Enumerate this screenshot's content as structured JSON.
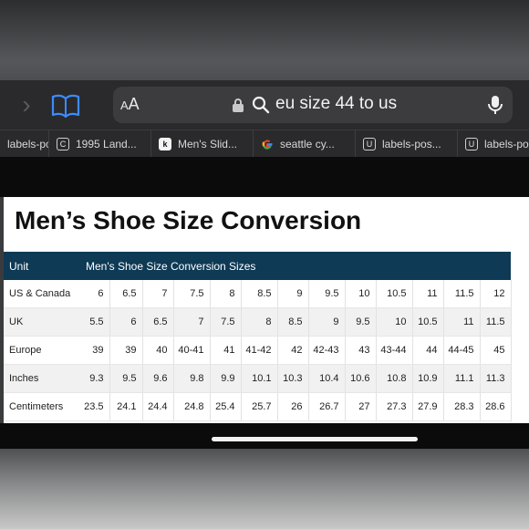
{
  "browser": {
    "text_size_label": "AA",
    "url": "eu size 44 to us",
    "tabs": [
      {
        "label": "labels-po",
        "icon": "U"
      },
      {
        "label": "1995 Land...",
        "icon": "C"
      },
      {
        "label": "Men's Slid...",
        "icon": "k"
      },
      {
        "label": "seattle cy...",
        "icon": "G"
      },
      {
        "label": "labels-pos...",
        "icon": "U"
      },
      {
        "label": "labels-po",
        "icon": "U"
      }
    ]
  },
  "page": {
    "title": "Men’s Shoe Size Conversion",
    "table": {
      "headers": [
        "Unit",
        "Men's Shoe Size Conversion Sizes"
      ],
      "rows": [
        {
          "label": "US & Canada",
          "values": [
            "6",
            "6.5",
            "7",
            "7.5",
            "8",
            "8.5",
            "9",
            "9.5",
            "10",
            "10.5",
            "11",
            "11.5",
            "12"
          ]
        },
        {
          "label": "UK",
          "values": [
            "5.5",
            "6",
            "6.5",
            "7",
            "7.5",
            "8",
            "8.5",
            "9",
            "9.5",
            "10",
            "10.5",
            "11",
            "11.5"
          ]
        },
        {
          "label": "Europe",
          "values": [
            "39",
            "39",
            "40",
            "40-41",
            "41",
            "41-42",
            "42",
            "42-43",
            "43",
            "43-44",
            "44",
            "44-45",
            "45"
          ]
        },
        {
          "label": "Inches",
          "values": [
            "9.3",
            "9.5",
            "9.6",
            "9.8",
            "9.9",
            "10.1",
            "10.3",
            "10.4",
            "10.6",
            "10.8",
            "10.9",
            "11.1",
            "11.3"
          ]
        },
        {
          "label": "Centimeters",
          "values": [
            "23.5",
            "24.1",
            "24.4",
            "24.8",
            "25.4",
            "25.7",
            "26",
            "26.7",
            "27",
            "27.3",
            "27.9",
            "28.3",
            "28.6"
          ]
        }
      ]
    }
  },
  "colors": {
    "table_header_bg": "#0e3a55",
    "toolbar_bg": "#2a2a2c",
    "link_blue": "#3b8cff"
  }
}
